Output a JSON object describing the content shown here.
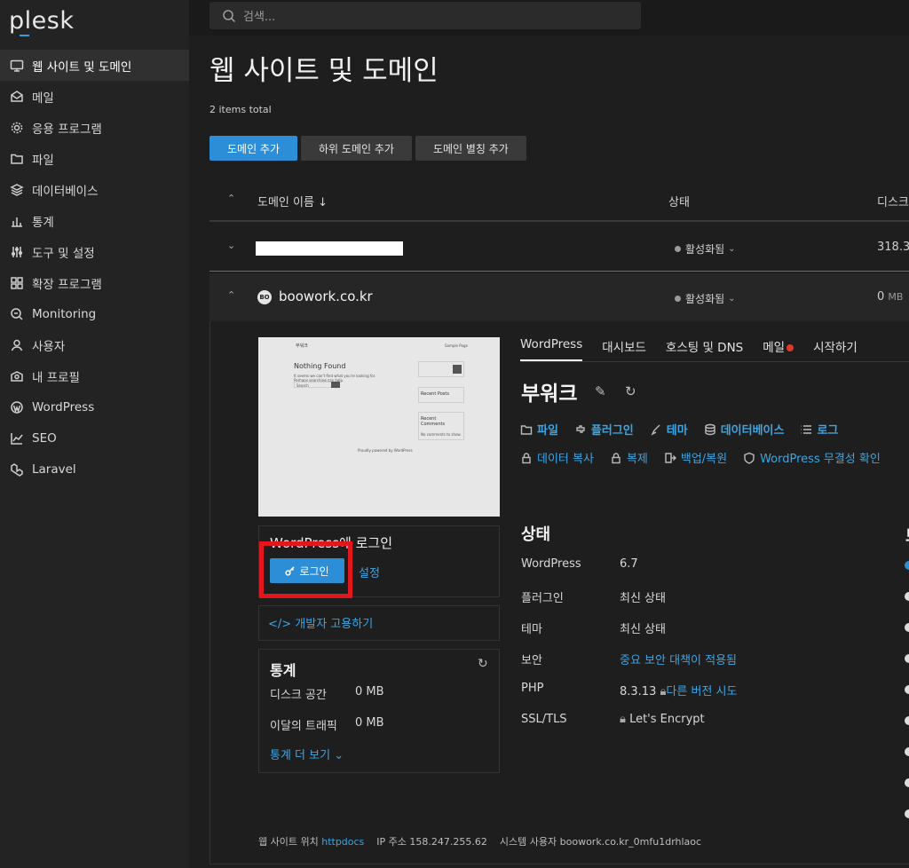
{
  "app": {
    "logo": "plesk"
  },
  "search": {
    "placeholder": "검색..."
  },
  "sidebar": {
    "items": [
      {
        "label": "웹 사이트 및 도메인",
        "icon": "monitor-icon"
      },
      {
        "label": "메일",
        "icon": "mail-icon"
      },
      {
        "label": "응용 프로그램",
        "icon": "gear-icon"
      },
      {
        "label": "파일",
        "icon": "folder-icon"
      },
      {
        "label": "데이터베이스",
        "icon": "layers-icon"
      },
      {
        "label": "통계",
        "icon": "bar-chart-icon"
      },
      {
        "label": "도구 및 설정",
        "icon": "sliders-icon"
      },
      {
        "label": "확장 프로그램",
        "icon": "puzzle-icon"
      },
      {
        "label": "Monitoring",
        "icon": "monitoring-icon"
      },
      {
        "label": "사용자",
        "icon": "user-icon"
      },
      {
        "label": "내 프로필",
        "icon": "profile-icon"
      },
      {
        "label": "WordPress",
        "icon": "wordpress-icon"
      },
      {
        "label": "SEO",
        "icon": "seo-icon"
      },
      {
        "label": "Laravel",
        "icon": "laravel-icon"
      }
    ],
    "collapse_glyph": "‹"
  },
  "page": {
    "title": "웹 사이트 및 도메인",
    "items_total": "2 items total"
  },
  "toolbar": {
    "add_domain": "도메인 추가",
    "add_subdomain": "하위 도메인 추가",
    "add_alias": "도메인 별칭 추가"
  },
  "table": {
    "headers": {
      "name": "도메인 이름 ↓",
      "status": "상태",
      "disk": "디스크"
    },
    "rows": [
      {
        "name": "",
        "status": "활성화됨",
        "disk": "318.3"
      },
      {
        "name": "boowork.co.kr",
        "status": "활성화됨",
        "disk": "0",
        "disk_unit": "MB",
        "icon_text": "BO"
      }
    ]
  },
  "panel": {
    "thumbnail": {
      "header_left": "부워크",
      "header_right": "Sample Page",
      "heading": "Nothing Found",
      "body": "It seems we can't find what you're looking for. Perhaps searching can help.",
      "search_label": "Search",
      "sidebar_recent_posts": "Recent Posts",
      "sidebar_recent_comments": "Recent Comments",
      "comments_empty": "No comments to show.",
      "footer": "Proudly powered by WordPress"
    },
    "login": {
      "title": "WordPress에 로그인",
      "button": "로그인",
      "settings": "설정"
    },
    "dev": {
      "label": "</> 개발자 고용하기"
    },
    "stats": {
      "title": "통계",
      "disk_label": "디스크 공간",
      "disk_value": "0 MB",
      "traffic_label": "이달의 트래픽",
      "traffic_value": "0 MB",
      "more": "통계 더 보기 ⌄"
    },
    "tabs": [
      "WordPress",
      "대시보드",
      "호스팅 및 DNS",
      "메일",
      "시작하기"
    ],
    "site_title": "부워크",
    "links_row1": [
      "파일",
      "플러그인",
      "테마",
      "데이터베이스",
      "로그"
    ],
    "links_row2": [
      "데이터 복사",
      "복제",
      "백업/복원",
      "WordPress 무결성 확인"
    ],
    "status": {
      "heading": "상태",
      "rows": [
        {
          "key": "WordPress",
          "value": "6.7"
        },
        {
          "key": "플러그인",
          "value": "최신 상태"
        },
        {
          "key": "테마",
          "value": "최신 상태"
        },
        {
          "key": "보안",
          "value": "중요 보안 대책이 적용됨"
        },
        {
          "key": "PHP",
          "value": "8.3.13",
          "extra": "다른 버전 시도"
        },
        {
          "key": "SSL/TLS",
          "value": "Let's Encrypt"
        }
      ],
      "right_heading_cut": "보"
    },
    "footer": {
      "location_label": "웹 사이트 위치",
      "location_value": "httpdocs",
      "ip_label": "IP 주소",
      "ip_value": "158.247.255.62",
      "user_label": "시스템 사용자",
      "user_value": "boowork.co.kr_0mfu1drhlaoc"
    }
  },
  "colors": {
    "accent": "#2b8ed6",
    "link": "#3ba5e6",
    "highlight_box": "#e3161e"
  }
}
